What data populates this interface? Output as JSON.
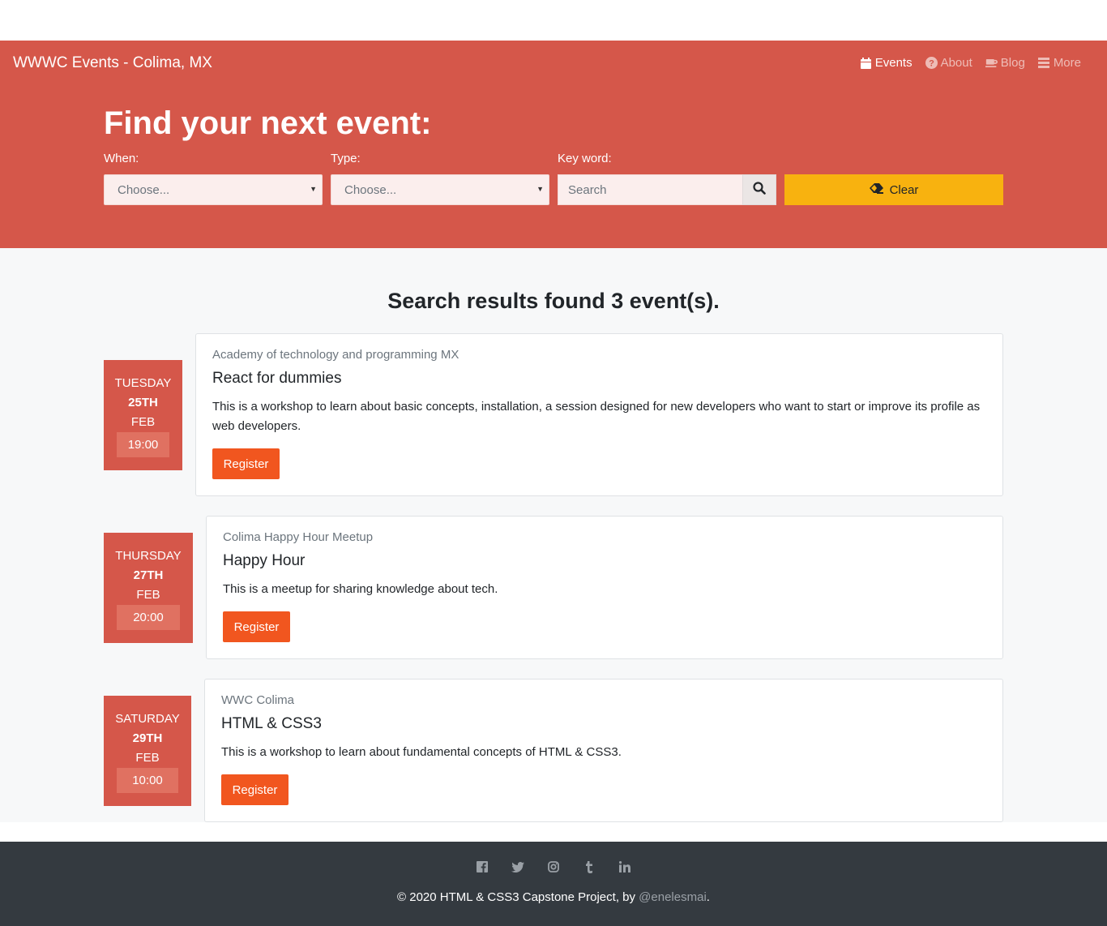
{
  "navbar": {
    "brand": "WWWC Events - Colima, MX",
    "items": [
      {
        "label": "Events",
        "icon": "calendar-icon",
        "active": true
      },
      {
        "label": "About",
        "icon": "question-circle-icon",
        "active": false
      },
      {
        "label": "Blog",
        "icon": "coffee-icon",
        "active": false
      },
      {
        "label": "More",
        "icon": "menu-icon",
        "active": false
      }
    ]
  },
  "hero": {
    "title": "Find your next event:",
    "when_label": "When:",
    "when_value": "Choose...",
    "type_label": "Type:",
    "type_value": "Choose...",
    "keyword_label": "Key word:",
    "search_placeholder": "Search",
    "clear_label": "Clear"
  },
  "results": {
    "title": "Search results found 3 event(s).",
    "events": [
      {
        "weekday": "TUESDAY",
        "day": "25TH",
        "month": "FEB",
        "time": "19:00",
        "organizer": "Academy of technology and programming MX",
        "title": "React for dummies",
        "description": "This is a workshop to learn about basic concepts, installation, a session designed for new developers who want to start or improve its profile as web developers.",
        "register_label": "Register"
      },
      {
        "weekday": "THURSDAY",
        "day": "27TH",
        "month": "FEB",
        "time": "20:00",
        "organizer": "Colima Happy Hour Meetup",
        "title": "Happy Hour",
        "description": "This is a meetup for sharing knowledge about tech.",
        "register_label": "Register"
      },
      {
        "weekday": "SATURDAY",
        "day": "29TH",
        "month": "FEB",
        "time": "10:00",
        "organizer": "WWC Colima",
        "title": "HTML & CSS3",
        "description": "This is a workshop to learn about fundamental concepts of HTML & CSS3.",
        "register_label": "Register"
      }
    ]
  },
  "footer": {
    "social": [
      "facebook-icon",
      "twitter-icon",
      "instagram-icon",
      "tumblr-icon",
      "linkedin-icon"
    ],
    "copyright": "© 2020 HTML & CSS3 Capstone Project, by ",
    "handle": "@enelesmai",
    "period": "."
  },
  "colors": {
    "brand": "#d5574a",
    "register": "#f1561f",
    "clear": "#f8b20f",
    "footer": "#343a40"
  }
}
